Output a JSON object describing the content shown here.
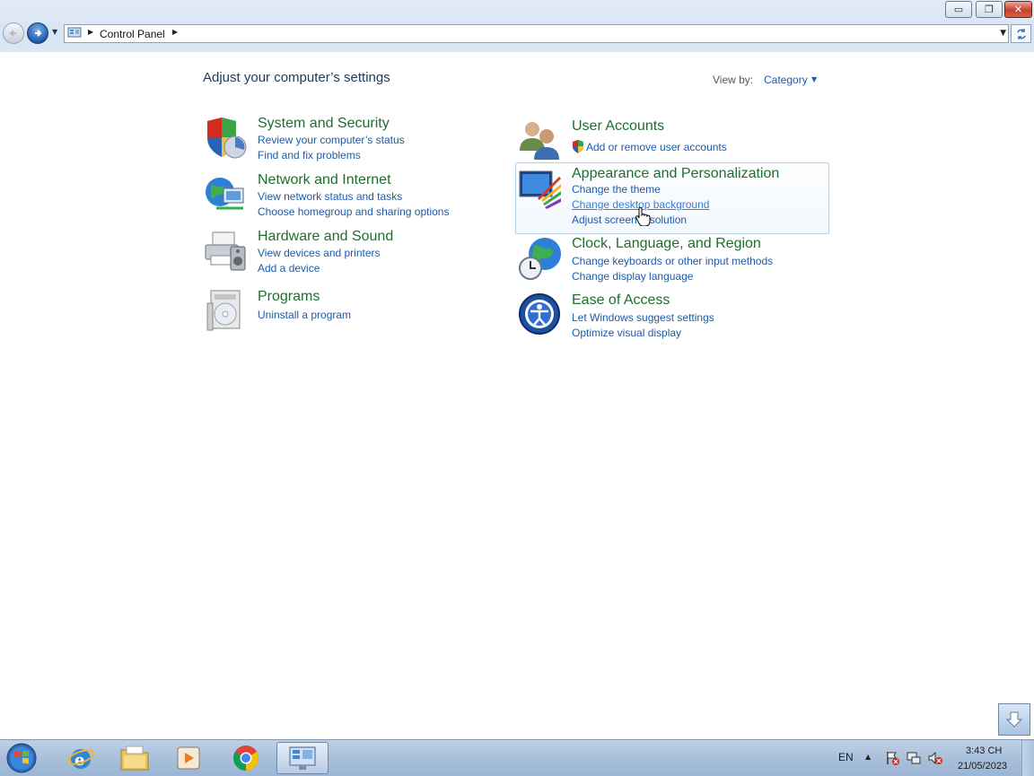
{
  "window": {
    "minimize_label": "▭",
    "maximize_label": "❐",
    "close_label": "✕"
  },
  "address": {
    "breadcrumb": "Control Panel"
  },
  "header": {
    "title": "Adjust your computer’s settings",
    "view_by_label": "View by:",
    "view_by_value": "Category"
  },
  "categories": {
    "system_security": {
      "title": "System and Security",
      "links": [
        "Review your computer’s status",
        "Find and fix problems"
      ]
    },
    "network_internet": {
      "title": "Network and Internet",
      "links": [
        "View network status and tasks",
        "Choose homegroup and sharing options"
      ]
    },
    "hardware_sound": {
      "title": "Hardware and Sound",
      "links": [
        "View devices and printers",
        "Add a device"
      ]
    },
    "programs": {
      "title": "Programs",
      "links": [
        "Uninstall a program"
      ]
    },
    "user_accounts": {
      "title": "User Accounts",
      "links": [
        "Add or remove user accounts"
      ]
    },
    "appearance": {
      "title": "Appearance and Personalization",
      "links": [
        "Change the theme",
        "Change desktop background",
        "Adjust screen resolution"
      ]
    },
    "clock_region": {
      "title": "Clock, Language, and Region",
      "links": [
        "Change keyboards or other input methods",
        "Change display language"
      ]
    },
    "ease_access": {
      "title": "Ease of Access",
      "links": [
        "Let Windows suggest settings",
        "Optimize visual display"
      ]
    }
  },
  "taskbar": {
    "apps": [
      "internet-explorer",
      "windows-explorer",
      "media-player",
      "chrome",
      "control-panel"
    ],
    "language": "EN",
    "time": "3:43 CH",
    "date": "21/05/2023"
  },
  "colors": {
    "category_title": "#1e6e2e",
    "link": "#1e5aa8",
    "hover_link": "#3a7bd5"
  }
}
